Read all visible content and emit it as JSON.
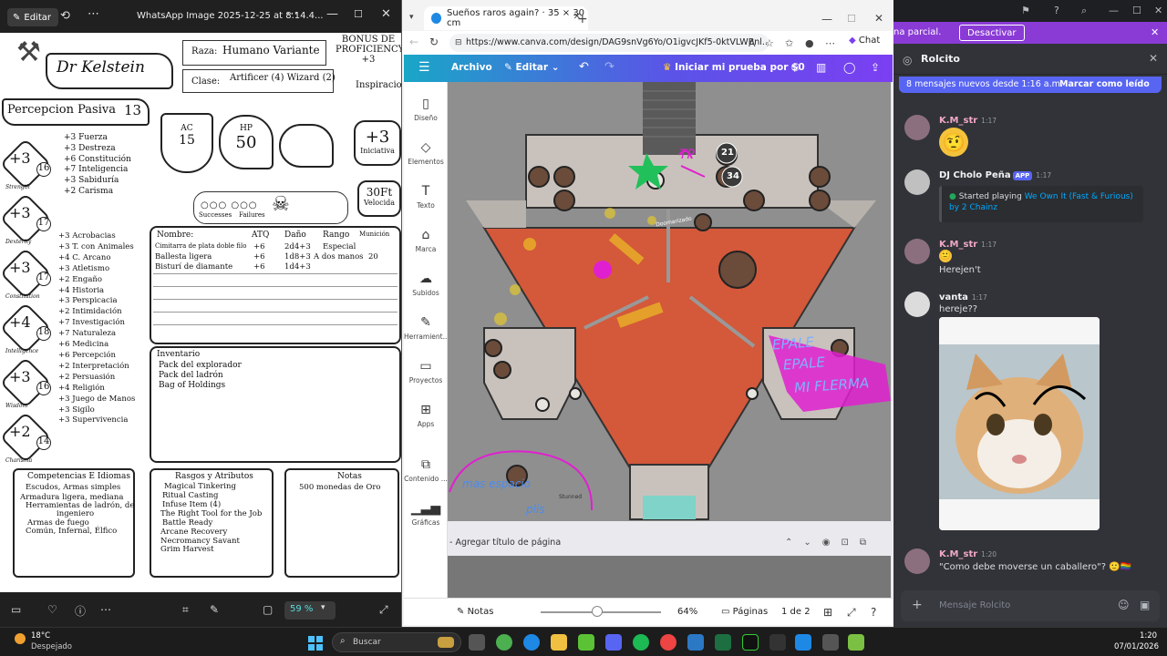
{
  "photos": {
    "edit_label": "Editar",
    "file_name": "WhatsApp Image 2025-12-25 at 8.14.4...",
    "zoom": "59 %"
  },
  "sheet": {
    "char_name": "Dr Kelstein",
    "raza_label": "Raza:",
    "raza_value": "Humano Variante",
    "clase_label": "Clase:",
    "clase_value": "Artificer (4) Wizard (2)",
    "bonus_label": "BONUS DE PROFICIENCY",
    "bonus_value": "+3",
    "inspiracion": "Inspiracio",
    "percepcion_label": "Percepcion Pasiva",
    "percepcion_value": "13",
    "ac_label": "AC",
    "ac_value": "15",
    "hp_label": "HP",
    "hp_value": "50",
    "init_value": "+3",
    "init_label": "Iniciativa",
    "speed_value": "30Ft",
    "speed_label": "Velocida",
    "successes": "Successes",
    "failures": "Failures",
    "stats": [
      {
        "mod": "+3",
        "score": "16",
        "label": "Strength"
      },
      {
        "mod": "+3",
        "score": "17",
        "label": "Dexterity"
      },
      {
        "mod": "+3",
        "score": "17",
        "label": "Constitution"
      },
      {
        "mod": "+4",
        "score": "18",
        "label": "Intelligence"
      },
      {
        "mod": "+3",
        "score": "16",
        "label": "Wisdom"
      },
      {
        "mod": "+2",
        "score": "14",
        "label": "Charisma"
      }
    ],
    "saves": [
      "+3 Fuerza",
      "+3 Destreza",
      "+6 Constitución",
      "+7 Inteligencia",
      "+3 Sabiduría",
      "+2 Carisma"
    ],
    "skills": [
      "+3 Acrobacias",
      "+3 T. con Animales",
      "+4 C. Arcano",
      "+3 Atletismo",
      "+2 Engaño",
      "+4 Historia",
      "+3 Perspicacia",
      "+2 Intimidación",
      "+7 Investigación",
      "+7 Naturaleza",
      "+6 Medicina",
      "+6 Percepción",
      "+2 Interpretación",
      "+2 Persuasión",
      "+4 Religión",
      "+3 Juego de Manos",
      "+3 Sigilo",
      "+3 Supervivencia"
    ],
    "attacks_header": [
      "Nombre:",
      "ATQ",
      "Daño",
      "Rango",
      "Munición"
    ],
    "attacks": [
      [
        "Cimitarra de plata doble filo",
        "+6",
        "2d4+3",
        "Especial",
        ""
      ],
      [
        "Ballesta ligera",
        "+6",
        "1d8+3",
        "A dos manos",
        "20"
      ],
      [
        "Bisturí de diamante",
        "+6",
        "1d4+3",
        "",
        ""
      ]
    ],
    "inventory_title": "Inventario",
    "inventory": [
      "Pack del explorador",
      "Pack del ladrón",
      "Bag of Holdings"
    ],
    "competencias_title": "Competencias E Idiomas",
    "competencias": [
      "Escudos, Armas simples",
      "Armadura ligera, mediana",
      "Herramientas de ladrón, de",
      "ingeniero",
      "Armas de fuego",
      "Común, Infernal, Élfico"
    ],
    "rasgos_title": "Rasgos y Atributos",
    "rasgos": [
      "Magical Tinkering",
      "Ritual Casting",
      "Infuse Item (4)",
      "The Right Tool for the Job",
      "Battle Ready",
      "Arcane Recovery",
      "Necromancy Savant",
      "Grim Harvest"
    ],
    "notas_title": "Notas",
    "notas": [
      "500 monedas de Oro"
    ]
  },
  "edge": {
    "tab_title": "Sueños raros again? · 35 × 30 cm",
    "url": "https://www.canva.com/design/DAG9snVg6Yo/O1igvcJKf5-0ktVLWBnl...",
    "copilot": "Chat"
  },
  "canva": {
    "archivo": "Archivo",
    "editar": "Editar",
    "trial": "Iniciar mi prueba por $0",
    "side": [
      "Diseño",
      "Elementos",
      "Texto",
      "Marca",
      "Subidos",
      "Herramient...",
      "Proyectos",
      "Apps",
      "Contenido ...",
      "Gráficas"
    ],
    "map_labels": {
      "token_21": "21",
      "token_34": "34",
      "doom": "Doomarizado",
      "stunned": "Stunned",
      "epale": "EPALE",
      "epale2": "EPALE",
      "mi_flerma": "MI FLERMA",
      "mas_espacio": "mas espacio",
      "plis": "plis",
      "tp": "TP"
    },
    "page_title": "- Agregar título de página",
    "notas": "Notas",
    "zoom": "64%",
    "paginas": "Páginas",
    "page_num": "1 de 2"
  },
  "discord": {
    "banner_text": "na parcial.",
    "banner_btn": "Desactivar",
    "channel": "Rolcito",
    "unread_text": "8 mensajes nuevos desde 1:16 a.m.",
    "unread_btn": "Marcar como leído",
    "messages": [
      {
        "author": "K.M_str",
        "time": "1:17",
        "text": ""
      },
      {
        "author": "DJ Cholo Peña",
        "badge": "APP",
        "time": "1:17",
        "activity": "Started playing",
        "song": "We Own It (Fast & Furious) by 2 Chainz"
      },
      {
        "author": "K.M_str",
        "time": "1:17",
        "text": "Herejen't"
      },
      {
        "author": "vanta",
        "time": "1:17",
        "text": "hereje??"
      },
      {
        "author": "K.M_str",
        "time": "1:20",
        "text": "\"Como debe moverse un caballero\"?"
      }
    ],
    "input_placeholder": "Mensaje Rolcito"
  },
  "taskbar": {
    "temp": "18°C",
    "weather": "Despejado",
    "search": "Buscar",
    "time": "1:20",
    "date": "07/01/2026"
  },
  "colors": {
    "canva_gradient_start": "#1aa6c7",
    "canva_gradient_end": "#7b3ff2",
    "discord_bg": "#313338",
    "discord_banner": "#8a3bd6",
    "discord_unread": "#5865f2",
    "lava": "#d4583a"
  }
}
